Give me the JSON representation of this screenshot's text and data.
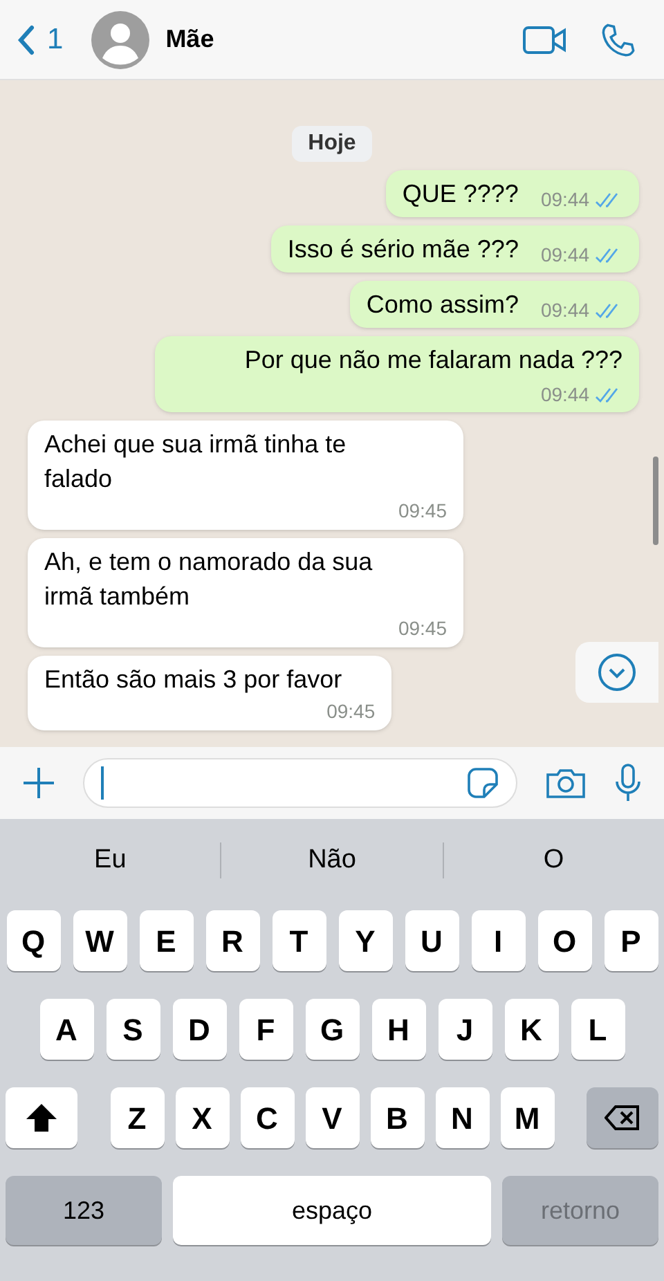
{
  "header": {
    "back_count": "1",
    "contact": "Mãe"
  },
  "date_chip": "Hoje",
  "messages": [
    {
      "kind": "out",
      "text": "QUE ????",
      "time": "09:44",
      "read": true
    },
    {
      "kind": "out",
      "text": "Isso é sério mãe ???",
      "time": "09:44",
      "read": true
    },
    {
      "kind": "out",
      "text": "Como assim?",
      "time": "09:44",
      "read": true
    },
    {
      "kind": "out",
      "text": "Por que não me falaram nada ???",
      "time": "09:44",
      "read": true
    },
    {
      "kind": "in",
      "text": "Achei que sua irmã tinha te falado",
      "time": "09:45"
    },
    {
      "kind": "in",
      "text": "Ah, e tem o namorado da sua irmã também",
      "time": "09:45"
    },
    {
      "kind": "in",
      "text": "Então são mais 3 por favor",
      "time": "09:45"
    }
  ],
  "suggestions": [
    "Eu",
    "Não",
    "O"
  ],
  "keyboard": {
    "rows": [
      [
        "Q",
        "W",
        "E",
        "R",
        "T",
        "Y",
        "U",
        "I",
        "O",
        "P"
      ],
      [
        "A",
        "S",
        "D",
        "F",
        "G",
        "H",
        "J",
        "K",
        "L"
      ],
      [
        "Z",
        "X",
        "C",
        "V",
        "B",
        "N",
        "M"
      ]
    ],
    "numbers": "123",
    "space": "espaço",
    "return": "retorno"
  }
}
